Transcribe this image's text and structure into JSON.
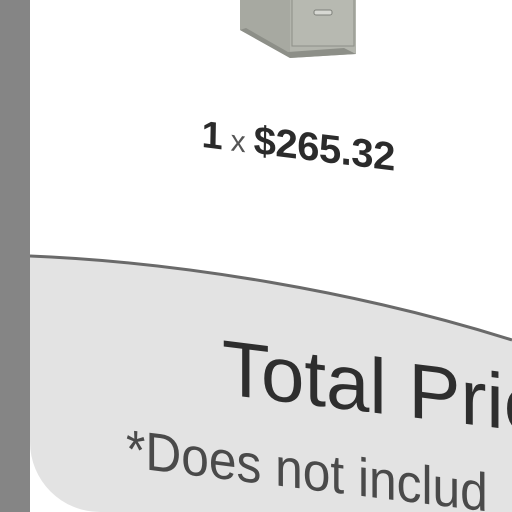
{
  "cart_item": {
    "quantity": "1",
    "times_symbol": "x",
    "unit_price": "$265.32"
  },
  "summary": {
    "total_label": "Total Price",
    "disclaimer": "*Does not includ"
  },
  "colors": {
    "bezel": "#858585",
    "panel": "#e3e3e3",
    "panel_edge": "#6a6a6a",
    "text": "#2e2e2e"
  }
}
